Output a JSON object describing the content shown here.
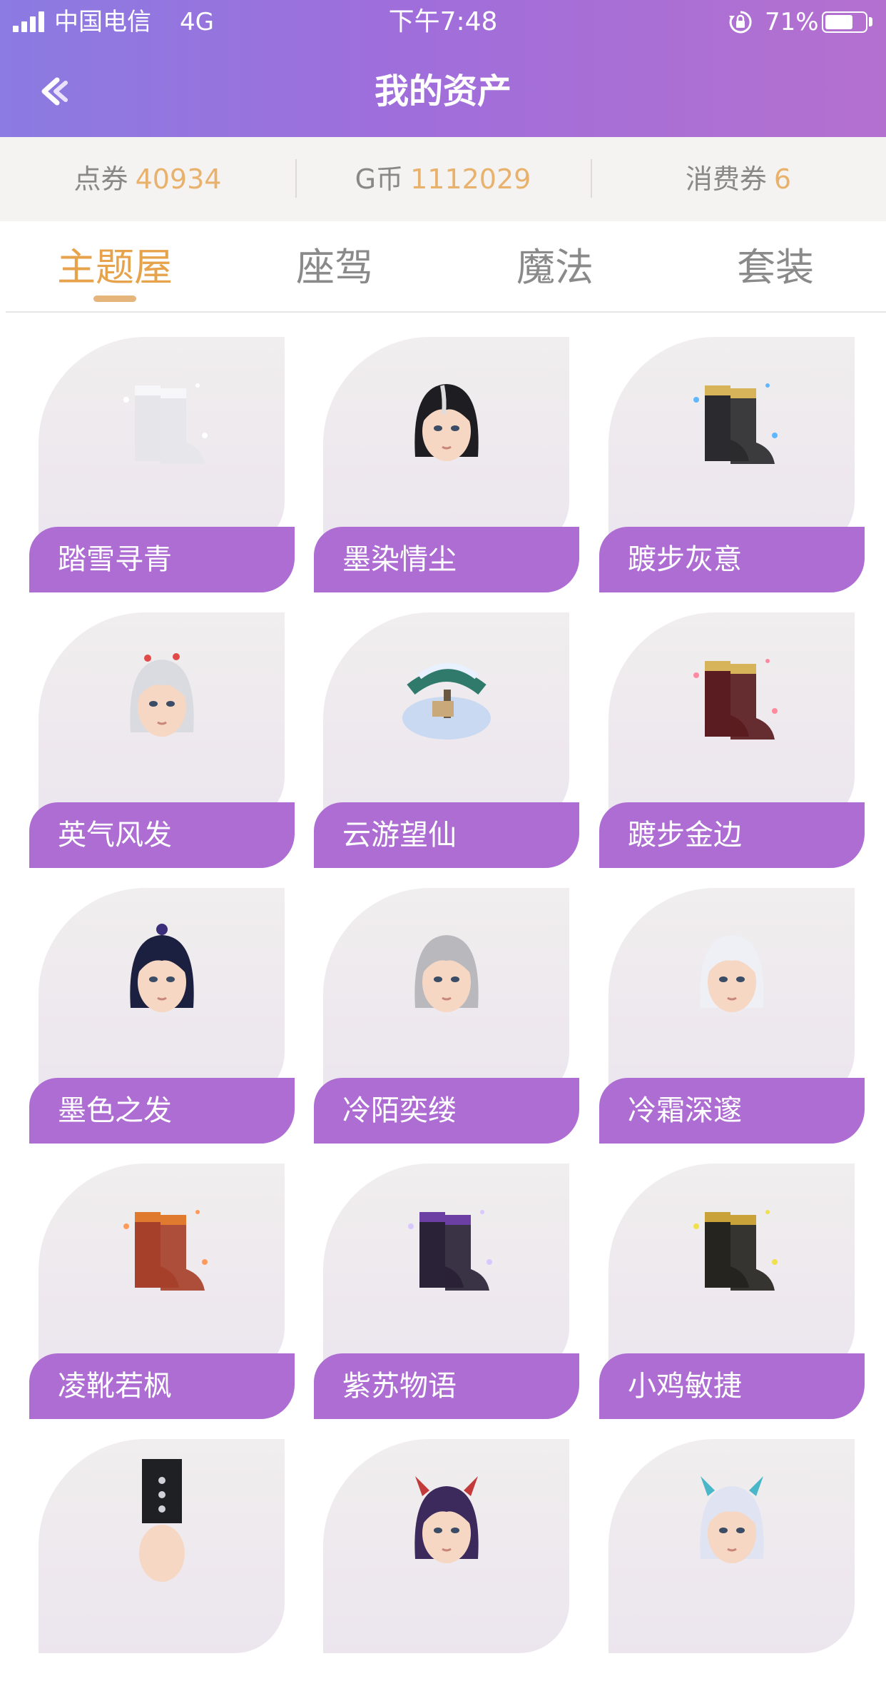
{
  "status_bar": {
    "carrier": "中国电信",
    "network": "4G",
    "time": "下午7:48",
    "battery": "71%",
    "battery_level": 0.71,
    "icons": [
      "signal-icon",
      "orientation-lock-icon",
      "battery-icon"
    ]
  },
  "header": {
    "title": "我的资产",
    "back_icon": "back-arrow-icon"
  },
  "balances": [
    {
      "label": "点券",
      "value": "40934"
    },
    {
      "label": "G币",
      "value": "1112029"
    },
    {
      "label": "消费券",
      "value": "6"
    }
  ],
  "tabs": [
    {
      "label": "主题屋",
      "active": true
    },
    {
      "label": "座驾",
      "active": false
    },
    {
      "label": "魔法",
      "active": false
    },
    {
      "label": "套装",
      "active": false
    }
  ],
  "items": [
    {
      "name": "踏雪寻青",
      "icon": "white-boots"
    },
    {
      "name": "墨染情尘",
      "icon": "black-hair-head"
    },
    {
      "name": "踱步灰意",
      "icon": "black-gold-boots"
    },
    {
      "name": "英气风发",
      "icon": "silver-hair-head"
    },
    {
      "name": "云游望仙",
      "icon": "snowy-pine-scene"
    },
    {
      "name": "踱步金边",
      "icon": "dark-red-boots"
    },
    {
      "name": "墨色之发",
      "icon": "dark-blue-hair-head"
    },
    {
      "name": "冷陌奕缕",
      "icon": "grey-hair-head"
    },
    {
      "name": "冷霜深邃",
      "icon": "white-hair-head"
    },
    {
      "name": "凌靴若枫",
      "icon": "red-flame-boots"
    },
    {
      "name": "紫苏物语",
      "icon": "purple-black-boots"
    },
    {
      "name": "小鸡敏捷",
      "icon": "black-gold-sparkle-boots"
    },
    {
      "name": "",
      "icon": "tall-hat-head"
    },
    {
      "name": "",
      "icon": "red-horn-head"
    },
    {
      "name": "",
      "icon": "blue-horn-head"
    }
  ],
  "colors": {
    "header_start": "#8b7be2",
    "header_end": "#b470cf",
    "accent_orange": "#e6a34c",
    "label_purple": "#ad6dd2"
  }
}
